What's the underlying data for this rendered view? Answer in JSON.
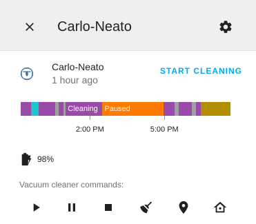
{
  "dialog": {
    "title": "Carlo-Neato",
    "close_icon": "close-icon",
    "settings_icon": "gear-icon"
  },
  "entity": {
    "icon": "robot-vacuum-icon",
    "name": "Carlo-Neato",
    "last_changed": "1 hour ago",
    "action_label": "START CLEANING",
    "accent_color": "#03a9f4"
  },
  "history": {
    "segments": [
      {
        "state": "",
        "label": "",
        "color": "#9a4aa8",
        "fraction": 0.05
      },
      {
        "state": "",
        "label": "",
        "color": "#1bc5c9",
        "fraction": 0.035
      },
      {
        "state": "",
        "label": "",
        "color": "#9a4aa8",
        "fraction": 0.08
      },
      {
        "state": "",
        "label": "",
        "color": "#a0a0a0",
        "fraction": 0.015
      },
      {
        "state": "",
        "label": "",
        "color": "#9a4aa8",
        "fraction": 0.025
      },
      {
        "state": "",
        "label": "",
        "color": "#a0a0a0",
        "fraction": 0.01
      },
      {
        "state": "cleaning",
        "label": "Cleaning",
        "color": "#9a4aa8",
        "fraction": 0.175
      },
      {
        "state": "paused",
        "label": "Paused",
        "color": "#ff7b00",
        "fraction": 0.29
      },
      {
        "state": "",
        "label": "",
        "color": "#9a4aa8",
        "fraction": 0.055
      },
      {
        "state": "",
        "label": "",
        "color": "#a0a0a0",
        "fraction": 0.02
      },
      {
        "state": "",
        "label": "",
        "color": "#9a4aa8",
        "fraction": 0.06
      },
      {
        "state": "",
        "label": "",
        "color": "#a0a0a0",
        "fraction": 0.02
      },
      {
        "state": "",
        "label": "",
        "color": "#9a4aa8",
        "fraction": 0.025
      },
      {
        "state": "",
        "label": "",
        "color": "#b28f00",
        "fraction": 0.14
      }
    ],
    "ticks": [
      {
        "label": "2:00 PM",
        "fraction": 0.33
      },
      {
        "label": "5:00 PM",
        "fraction": 0.685
      }
    ]
  },
  "battery": {
    "icon": "battery-charging-icon",
    "level": "98%"
  },
  "commands": {
    "label": "Vacuum cleaner commands:",
    "items": [
      {
        "name": "start",
        "icon": "play-icon"
      },
      {
        "name": "pause",
        "icon": "pause-icon"
      },
      {
        "name": "stop",
        "icon": "stop-icon"
      },
      {
        "name": "clean-spot",
        "icon": "broom-icon"
      },
      {
        "name": "locate",
        "icon": "map-marker-icon"
      },
      {
        "name": "return-home",
        "icon": "home-icon"
      }
    ]
  }
}
